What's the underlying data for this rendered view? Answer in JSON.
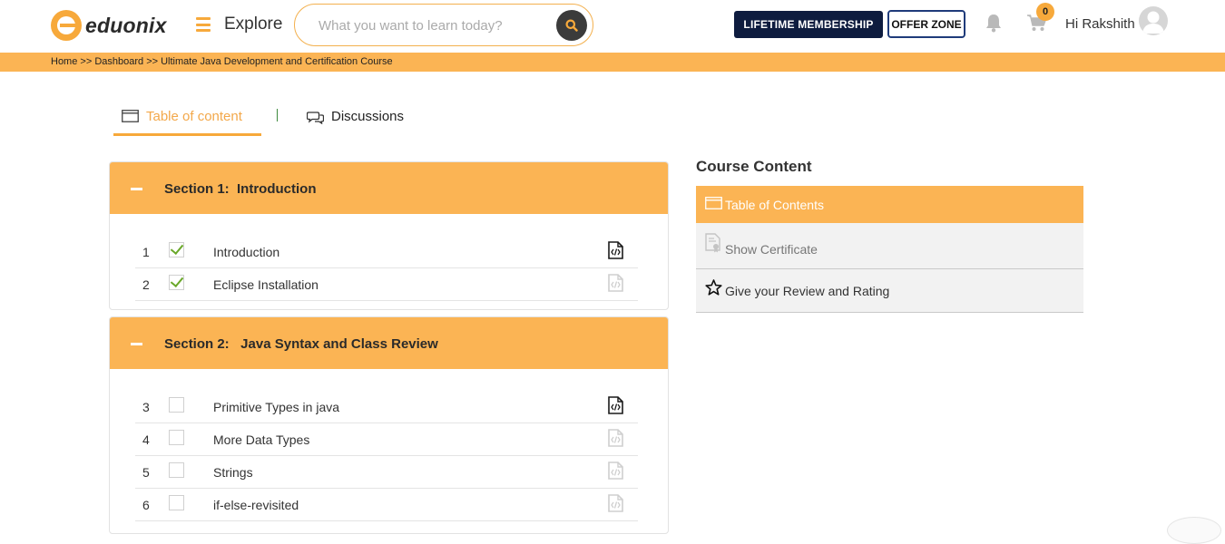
{
  "header": {
    "logo_text": "eduonix",
    "explore_label": "Explore",
    "search_placeholder": "What you want to learn today?",
    "lifetime_label": "LIFETIME MEMBERSHIP",
    "offer_label": "OFFER ZONE",
    "cart_count": "0",
    "greeting": "Hi Rakshith"
  },
  "breadcrumb": {
    "home": "Home",
    "sep": " >> ",
    "dashboard": "Dashboard",
    "course": "Ultimate Java Development and Certification Course"
  },
  "tabs": {
    "toc_label": "Table of content",
    "discussions_label": "Discussions"
  },
  "sections": [
    {
      "title": "Section 1:  Introduction",
      "lessons": [
        {
          "num": "1",
          "name": "Introduction",
          "done": true,
          "doc_active": true
        },
        {
          "num": "2",
          "name": "Eclipse Installation",
          "done": true,
          "doc_active": false
        }
      ]
    },
    {
      "title": "Section 2:   Java Syntax and Class Review",
      "lessons": [
        {
          "num": "3",
          "name": "Primitive Types in java",
          "done": false,
          "doc_active": true
        },
        {
          "num": "4",
          "name": "More Data Types",
          "done": false,
          "doc_active": false
        },
        {
          "num": "5",
          "name": "Strings",
          "done": false,
          "doc_active": false
        },
        {
          "num": "6",
          "name": "if-else-revisited",
          "done": false,
          "doc_active": false
        }
      ]
    }
  ],
  "course_content": {
    "title": "Course Content",
    "items": [
      {
        "label": "Table of Contents",
        "icon": "window-icon"
      },
      {
        "label": "Show Certificate",
        "icon": "certificate-icon"
      },
      {
        "label": "Give your Review and Rating",
        "icon": "star-icon"
      }
    ]
  },
  "colors": {
    "accent": "#fbb454",
    "navy": "#0e1c3f",
    "check": "#6aa82a"
  }
}
